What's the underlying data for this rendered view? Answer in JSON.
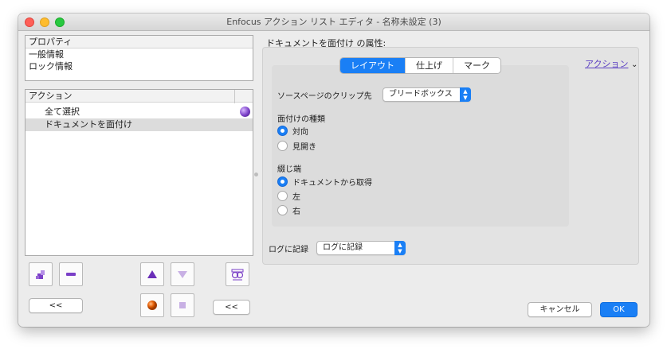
{
  "window": {
    "title": "Enfocus アクション リスト エディタ - 名称未設定 (3)"
  },
  "properties": {
    "header": "プロパティ",
    "items": [
      "一般情報",
      "ロック情報"
    ]
  },
  "actions": {
    "header": "アクション",
    "items": [
      "全て選択",
      "ドキュメントを面付け"
    ]
  },
  "left_buttons": {
    "collapse_label": "<<",
    "collapse2_label": "<<"
  },
  "right": {
    "title": "ドキュメントを面付け の属性:",
    "tabs": [
      "レイアウト",
      "仕上げ",
      "マーク"
    ],
    "actions_link": "アクション",
    "actions_chevron": "⌄",
    "clip_label": "ソースページのクリップ先",
    "clip_value": "ブリードボックス",
    "imposition_type_label": "面付けの種類",
    "imposition_type_options": [
      "対向",
      "見開き"
    ],
    "binding_label": "綴じ端",
    "binding_options": [
      "ドキュメントから取得",
      "左",
      "右"
    ],
    "log_label": "ログに記録",
    "log_value": "ログに記録"
  },
  "footer": {
    "cancel_label": "キャンセル",
    "ok_label": "OK"
  },
  "colors": {
    "accent": "#1a7ff5",
    "link": "#5b3fc2",
    "purple_icon": "#7a3fc7",
    "orange_icon": "#e8630a"
  }
}
